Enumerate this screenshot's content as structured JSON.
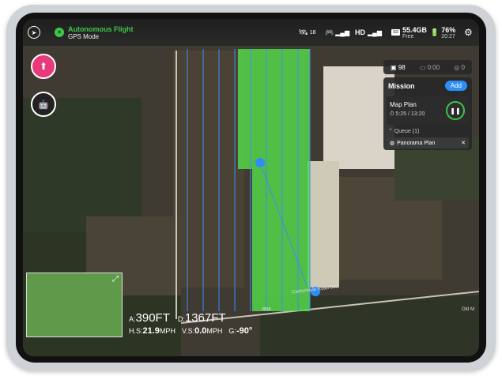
{
  "status": {
    "mode_title": "Autonomous Flight",
    "mode_sub": "GPS Mode",
    "satellites": "18",
    "hd_label": "HD",
    "storage": "55.4GB",
    "storage_sub": "Free",
    "battery": "76%",
    "time": "20:27"
  },
  "stats": {
    "photos": "98",
    "video_time": "0:00",
    "count": "0"
  },
  "mission": {
    "title": "Mission",
    "add_label": "Add",
    "plan_name": "Map Plan",
    "plan_time": "5:25 / 13:20",
    "queue_label": "Queue (1)",
    "queue_item": "Panorama Plan"
  },
  "hud": {
    "a_label": "A:",
    "a_value": "390FT",
    "d_label": "D:",
    "d_value": "1367FT",
    "hs_label": "H.S:",
    "hs_value": "21.9",
    "hs_unit": "MPH",
    "vs_label": "V.S:",
    "vs_value": "0.0",
    "vs_unit": "MPH",
    "g_label": "G:",
    "g_value": "-90°"
  },
  "map": {
    "road_label": "Carbondale Road SW",
    "road_label_2": "Old M",
    "route_label": "300A"
  },
  "colors": {
    "accent_green": "#3ec64c",
    "plan_green": "#55d64a",
    "accent_blue": "#2e8ef5"
  }
}
